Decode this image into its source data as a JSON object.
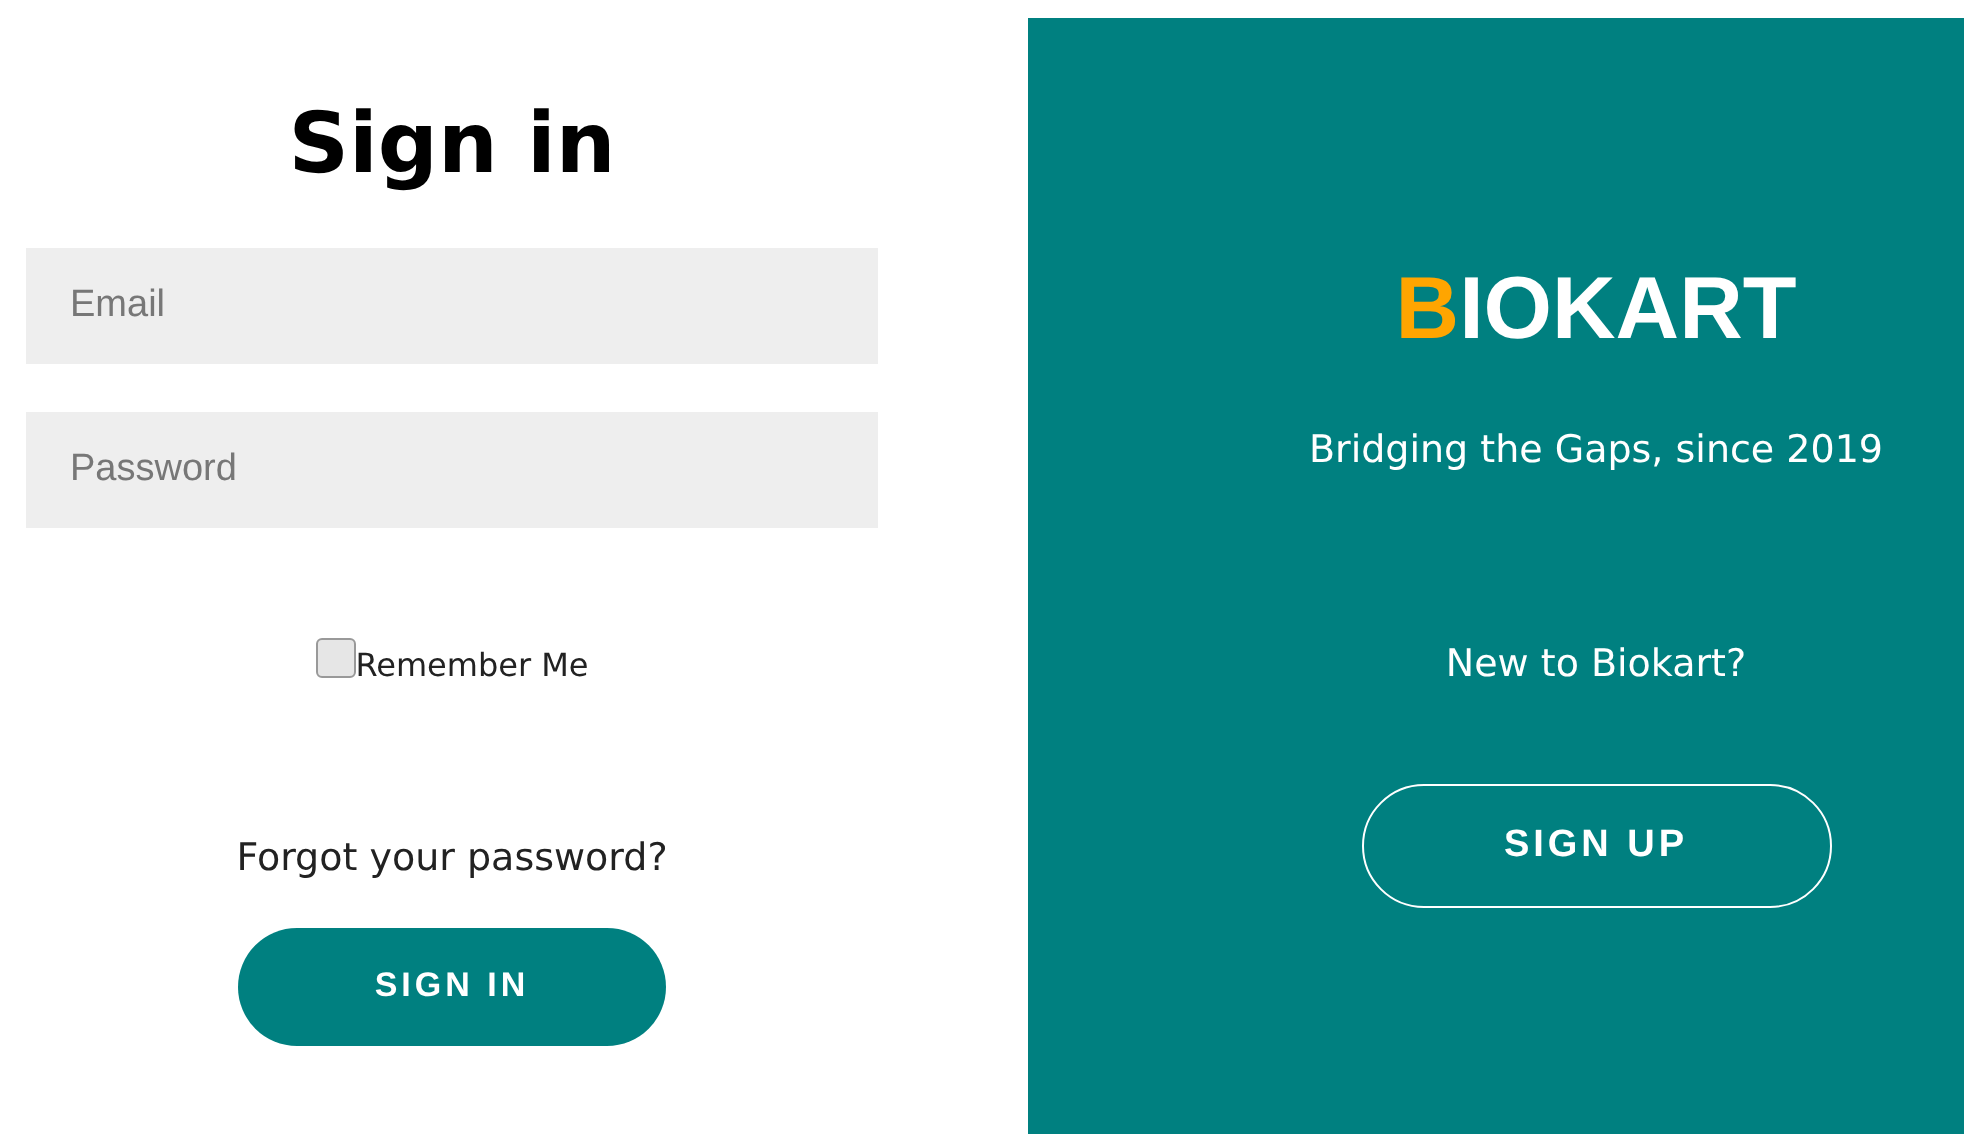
{
  "sign_in": {
    "title": "Sign in",
    "email": {
      "placeholder": "Email"
    },
    "password": {
      "placeholder": "Password"
    },
    "remember_me": {
      "label": "Remember Me",
      "checked": false
    },
    "forgot_link": "Forgot your password?",
    "button": "SIGN IN"
  },
  "promo": {
    "logo_accent": "B",
    "logo_rest": "IOKART",
    "tagline": "Bridging the Gaps, since 2019",
    "prompt": "New to Biokart?",
    "button": "SIGN UP"
  }
}
